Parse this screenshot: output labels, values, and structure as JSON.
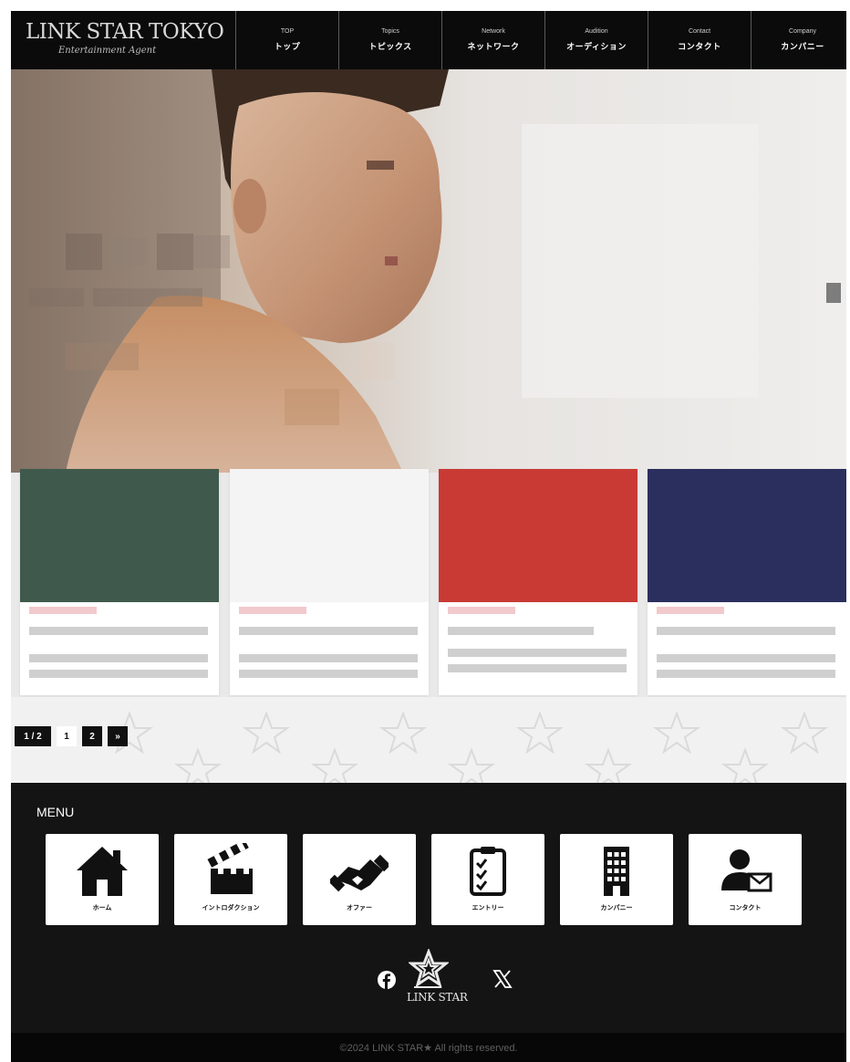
{
  "header": {
    "logo_main": "LINK STAR TOKYO",
    "logo_sub": "Entertainment Agent",
    "nav": [
      {
        "en": "TOP",
        "jp": "トップ"
      },
      {
        "en": "Topics",
        "jp": "トピックス"
      },
      {
        "en": "Network",
        "jp": "ネットワーク"
      },
      {
        "en": "Audition",
        "jp": "オーディション"
      },
      {
        "en": "Contact",
        "jp": "コンタクト"
      },
      {
        "en": "Company",
        "jp": "カンパニー"
      }
    ]
  },
  "hero": {
    "image": "pixelated-portrait-photo",
    "next_arrow": "slider-next-arrow"
  },
  "cards": [
    {
      "thumb_color": "#3f5a4c",
      "tag_color": "#f2c9cc"
    },
    {
      "thumb_color": "#f4f4f4",
      "tag_color": "#f2c9cc"
    },
    {
      "thumb_color": "#c93a34",
      "tag_color": "#f2c9cc"
    },
    {
      "thumb_color": "#2b2f5e",
      "tag_color": "#f2c9cc"
    }
  ],
  "pagination": {
    "count": "1 / 2",
    "current": "1",
    "next_page": "2",
    "next_arrow": "»"
  },
  "menu": {
    "title": "MENU",
    "items": [
      {
        "label": "ホーム",
        "icon": "home-icon"
      },
      {
        "label": "イントロダクション",
        "icon": "clapperboard-icon"
      },
      {
        "label": "オファー",
        "icon": "handshake-icon"
      },
      {
        "label": "エントリー",
        "icon": "clipboard-checklist-icon"
      },
      {
        "label": "カンパニー",
        "icon": "building-icon"
      },
      {
        "label": "コンタクト",
        "icon": "person-mail-icon"
      }
    ]
  },
  "social": {
    "brand": "LINK STAR",
    "facebook": "facebook-icon",
    "x": "x-icon"
  },
  "footer": {
    "copyright": "©2024 LINK STAR★ All rights reserved."
  },
  "colors": {
    "header_bg": "#0b0b0b",
    "menu_bg": "#141414",
    "footer_bg": "#070707",
    "tag_pink": "#f2c9cc"
  }
}
